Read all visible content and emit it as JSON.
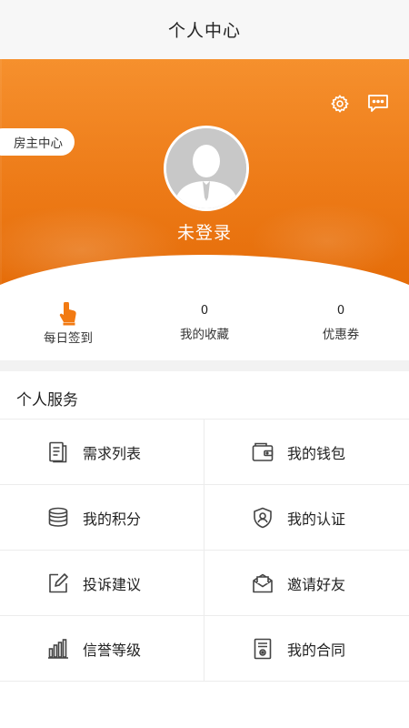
{
  "header": {
    "title": "个人中心"
  },
  "hero": {
    "owner_center": "房主中心",
    "login_status": "未登录",
    "icons": {
      "settings": "gear-icon",
      "messages": "chat-bubble-icon",
      "avatar": "default-user-avatar"
    }
  },
  "stats": [
    {
      "value": "",
      "label": "每日签到",
      "icon": "tap-hand-icon"
    },
    {
      "value": "0",
      "label": "我的收藏"
    },
    {
      "value": "0",
      "label": "优惠券"
    }
  ],
  "services": {
    "title": "个人服务",
    "items": [
      {
        "label": "需求列表",
        "icon": "document-list-icon"
      },
      {
        "label": "我的钱包",
        "icon": "wallet-icon"
      },
      {
        "label": "我的积分",
        "icon": "coin-stack-icon"
      },
      {
        "label": "我的认证",
        "icon": "shield-user-icon"
      },
      {
        "label": "投诉建议",
        "icon": "edit-pencil-icon"
      },
      {
        "label": "邀请好友",
        "icon": "envelope-invite-icon"
      },
      {
        "label": "信誉等级",
        "icon": "bar-level-icon"
      },
      {
        "label": "我的合同",
        "icon": "contract-icon"
      }
    ]
  },
  "colors": {
    "brand": "#f27a12",
    "text": "#222222",
    "divider": "#ececec"
  }
}
